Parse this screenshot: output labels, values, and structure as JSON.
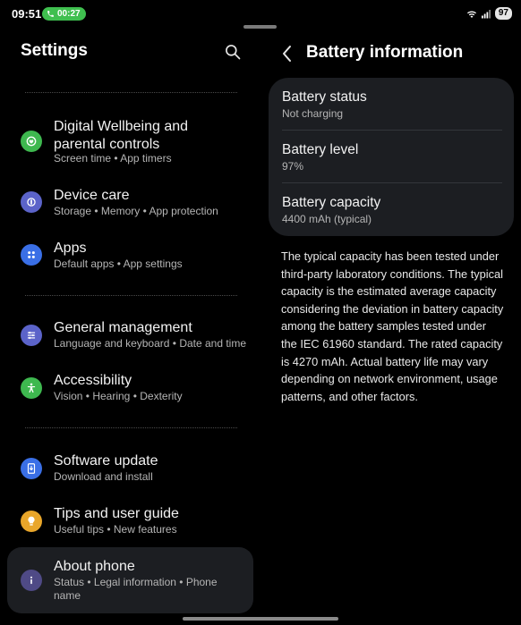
{
  "status_bar": {
    "time": "09:51",
    "call_duration": "00:27",
    "battery": "97",
    "icons": [
      "wifi-icon",
      "signal-icon"
    ]
  },
  "left": {
    "title": "Settings",
    "items": [
      {
        "title": "Digital Wellbeing and parental controls",
        "sub": "Screen time  •  App timers",
        "icon": "digital-wellbeing-icon",
        "color": "#3eb84f"
      },
      {
        "title": "Device care",
        "sub": "Storage  •  Memory  •  App protection",
        "icon": "device-care-icon",
        "color": "#5b63c9"
      },
      {
        "title": "Apps",
        "sub": "Default apps  •  App settings",
        "icon": "apps-icon",
        "color": "#3a6fe6"
      },
      {
        "title": "General management",
        "sub": "Language and keyboard  •  Date and time",
        "icon": "general-management-icon",
        "color": "#5b63c9"
      },
      {
        "title": "Accessibility",
        "sub": "Vision  •  Hearing  •  Dexterity",
        "icon": "accessibility-icon",
        "color": "#3eb84f"
      },
      {
        "title": "Software update",
        "sub": "Download and install",
        "icon": "software-update-icon",
        "color": "#3a6fe6"
      },
      {
        "title": "Tips and user guide",
        "sub": "Useful tips  •  New features",
        "icon": "tips-icon",
        "color": "#e9a62a"
      },
      {
        "title": "About phone",
        "sub": "Status  •  Legal information  •  Phone name",
        "icon": "about-phone-icon",
        "color": "#4f4a86"
      }
    ]
  },
  "right": {
    "title": "Battery information",
    "rows": [
      {
        "label": "Battery status",
        "value": "Not charging"
      },
      {
        "label": "Battery level",
        "value": "97%"
      },
      {
        "label": "Battery capacity",
        "value": "4400 mAh (typical)"
      }
    ],
    "description": "The typical capacity has been tested under third-party laboratory conditions. The typical capacity is the estimated average capacity considering the deviation in battery capacity among the battery samples tested under the IEC 61960 standard. The rated capacity is 4270 mAh. Actual battery life may vary depending on network environment, usage patterns, and other factors."
  }
}
